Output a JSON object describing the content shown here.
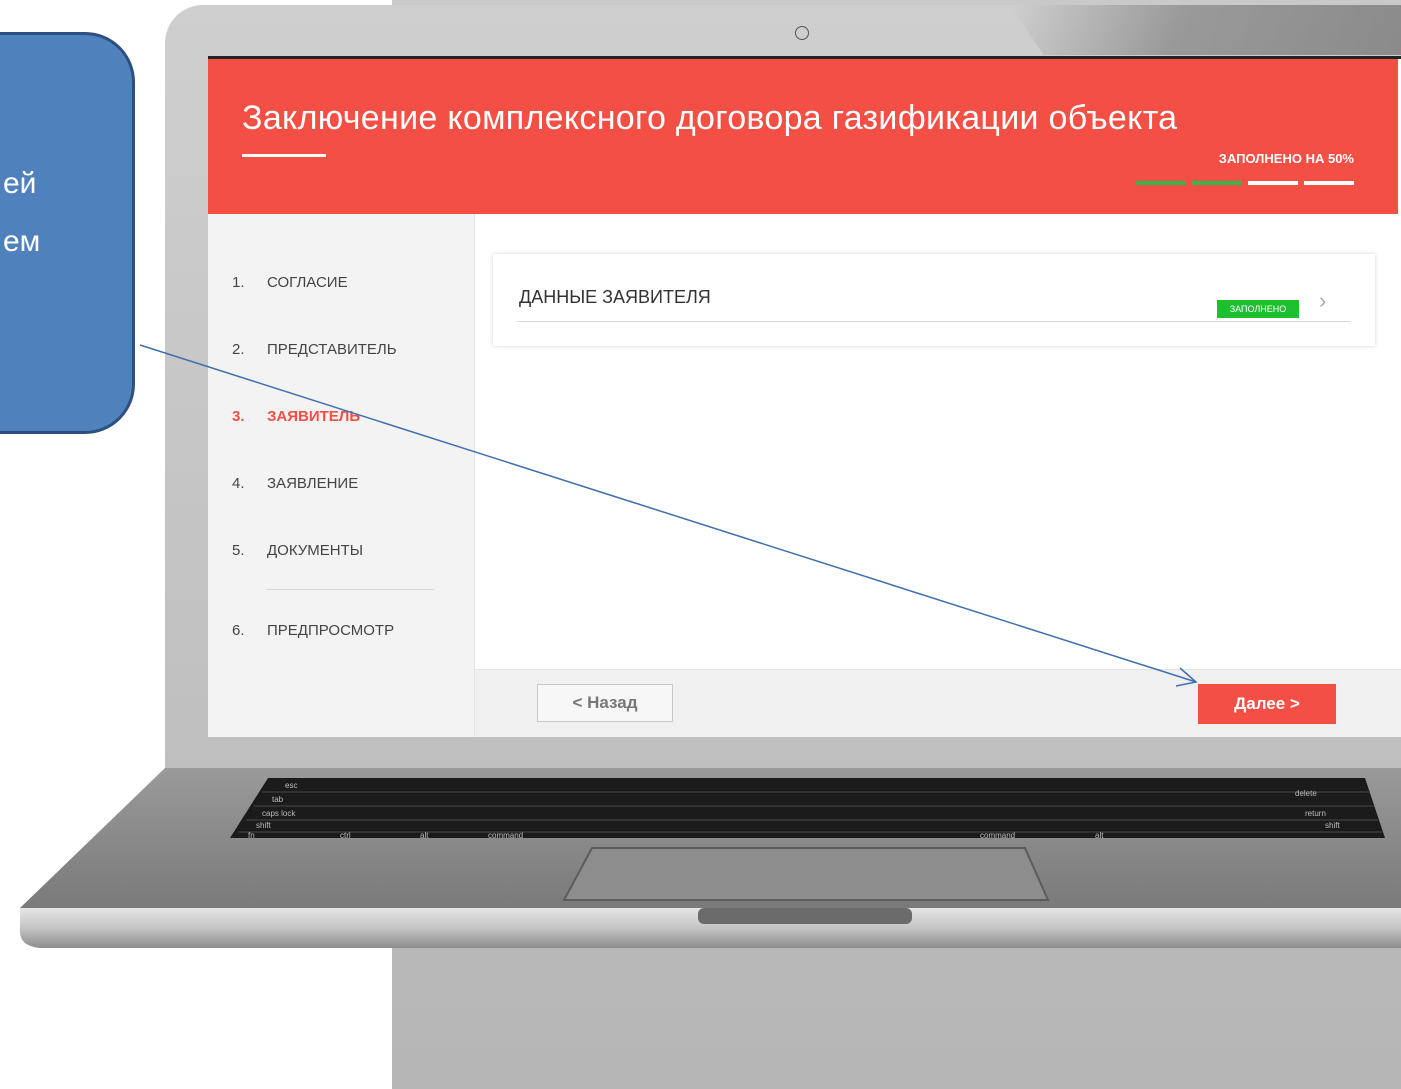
{
  "window": {
    "title": "Заключение комплексного договора газификации объекта",
    "progress_label": "ЗАПОЛНЕНО НА 50%",
    "progress_fraction": 0.5
  },
  "steps": [
    {
      "num": "1.",
      "label": "СОГЛАСИЕ"
    },
    {
      "num": "2.",
      "label": "ПРЕДСТАВИТЕЛЬ"
    },
    {
      "num": "3.",
      "label": "ЗАЯВИТЕЛЬ"
    },
    {
      "num": "4.",
      "label": "ЗАЯВЛЕНИЕ"
    },
    {
      "num": "5.",
      "label": "ДОКУМЕНТЫ"
    },
    {
      "num": "6.",
      "label": "ПРЕДПРОСМОТР"
    }
  ],
  "active_step": 3,
  "card": {
    "title": "ДАННЫЕ ЗАЯВИТЕЛЯ",
    "status": "ЗАПОЛНЕНО",
    "status_color": "#1fc02f"
  },
  "footer": {
    "back_label": "< Назад",
    "next_label": "Далее >"
  },
  "callout": {
    "text_line1": "ей",
    "text_line2": "ем"
  },
  "keyboard": {
    "keys": [
      "esc",
      "tab",
      "caps lock",
      "shift",
      "fn",
      "ctrl",
      "alt",
      "command",
      "command",
      "alt",
      "return",
      "shift",
      "delete"
    ]
  },
  "colors": {
    "accent": "#f34f45",
    "progress_done": "#38b54a",
    "callout": "#4f81bd"
  }
}
